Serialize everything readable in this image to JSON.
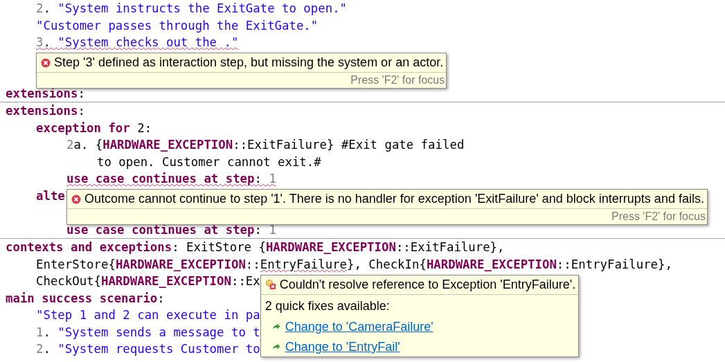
{
  "panels": [
    {
      "lines": [
        {
          "kind": "offscreen",
          "children": [
            {
              "kind": "code",
              "tokens": [
                {
                  "kind": "number",
                  "text": "2",
                  "error": false
                },
                {
                  "kind": "plain",
                  "text": ". ",
                  "error": false
                },
                {
                  "kind": "string",
                  "text": "\"System instructs the ExitGate to open.\"",
                  "error": false
                }
              ]
            },
            {
              "kind": "code",
              "tokens": [
                {
                  "kind": "string",
                  "text": "\"Customer passes through the ExitGate.\"",
                  "error": false
                }
              ]
            },
            {
              "kind": "code",
              "tokens": [
                {
                  "kind": "number",
                  "text": "3",
                  "error": true,
                  "tooltip": {
                    "kind": "error",
                    "message": "Step '3' defined as interaction step, but missing the system or an actor.",
                    "footer": "Press 'F2' for focus"
                  }
                },
                {
                  "kind": "plain",
                  "text": ". ",
                  "error": true
                },
                {
                  "kind": "string",
                  "text": "\"System checks out the .\"",
                  "error": true
                }
              ]
            },
            {
              "kind": "covered"
            },
            {
              "kind": "covered"
            }
          ]
        },
        {
          "kind": "code",
          "tokens": [
            {
              "kind": "keyword",
              "text": "extensions",
              "error": false
            },
            {
              "kind": "plain",
              "text": ":",
              "error": false
            }
          ]
        }
      ]
    },
    {
      "lines": [
        {
          "kind": "code",
          "tokens": [
            {
              "kind": "keyword",
              "text": "extensions",
              "error": false
            },
            {
              "kind": "plain",
              "text": ":",
              "error": false
            }
          ],
          "children": [
            {
              "kind": "code",
              "tokens": [
                {
                  "kind": "keyword",
                  "text": "exception for",
                  "error": false
                },
                {
                  "kind": "plain",
                  "text": " 2:",
                  "error": false
                }
              ],
              "children": [
                {
                  "kind": "code",
                  "tokens": [
                    {
                      "kind": "number",
                      "text": "2",
                      "error": false
                    },
                    {
                      "kind": "plain",
                      "text": "a. {",
                      "error": false
                    },
                    {
                      "kind": "keyword",
                      "text": "HARDWARE_EXCEPTION",
                      "error": false
                    },
                    {
                      "kind": "plain",
                      "text": "::ExitFailure} #Exit gate failed",
                      "error": false
                    }
                  ],
                  "children": [
                    {
                      "kind": "code",
                      "tokens": [
                        {
                          "kind": "plain",
                          "text": "to open. Customer cannot exit.#",
                          "error": false
                        }
                      ]
                    }
                  ]
                },
                {
                  "kind": "code",
                  "tokens": [
                    {
                      "kind": "keyword",
                      "text": "use case continues at step",
                      "error": true,
                      "tooltip": {
                        "kind": "error",
                        "message": "Outcome cannot continue to step '1'. There is no handler for exception 'ExitFailure' and block interrupts and fails.",
                        "footer": "Press 'F2' for focus"
                      }
                    },
                    {
                      "kind": "plain",
                      "text": ": ",
                      "error": true
                    },
                    {
                      "kind": "number",
                      "text": "1",
                      "error": true
                    }
                  ]
                }
              ]
            },
            {
              "kind": "code",
              "tokens": [
                {
                  "kind": "keyword",
                  "text": "alte",
                  "error": false
                }
              ],
              "children": [
                {
                  "kind": "covered"
                },
                {
                  "kind": "code",
                  "tokens": [
                    {
                      "kind": "keyword",
                      "text": "use case continues at step",
                      "error": false
                    },
                    {
                      "kind": "plain",
                      "text": ": ",
                      "error": false
                    },
                    {
                      "kind": "number",
                      "text": "1",
                      "error": false
                    }
                  ]
                }
              ]
            }
          ]
        }
      ]
    },
    {
      "lines": [
        {
          "kind": "code",
          "tokens": [
            {
              "kind": "keyword",
              "text": "contexts and exceptions",
              "error": false
            },
            {
              "kind": "plain",
              "text": ": ExitStore {",
              "error": false
            },
            {
              "kind": "keyword",
              "text": "HARDWARE_EXCEPTION",
              "error": false
            },
            {
              "kind": "plain",
              "text": "::ExitFailure},",
              "error": false
            }
          ],
          "children": [
            {
              "kind": "code",
              "tokens": [
                {
                  "kind": "plain",
                  "text": "EnterStore{",
                  "error": false
                },
                {
                  "kind": "keyword",
                  "text": "HARDWARE_EXCEPTION",
                  "error": false
                },
                {
                  "kind": "plain",
                  "text": "::",
                  "error": false
                },
                {
                  "kind": "plain",
                  "text": "EntryFailure",
                  "error": true,
                  "tooltip": {
                    "kind": "quickfix",
                    "message": "Couldn't resolve reference to Exception 'EntryFailure'.",
                    "fixes_title": "2 quick fixes available:",
                    "fixes": [
                      "Change to 'CameraFailure'",
                      "Change to 'EntryFail'"
                    ]
                  }
                },
                {
                  "kind": "plain",
                  "text": "}, CheckIn{",
                  "error": false
                },
                {
                  "kind": "keyword",
                  "text": "HARDWARE_EXCEPTION",
                  "error": false
                },
                {
                  "kind": "plain",
                  "text": "::EntryFailure},",
                  "error": false
                }
              ]
            },
            {
              "kind": "code",
              "tokens": [
                {
                  "kind": "plain",
                  "text": "CheckOut{",
                  "error": false
                },
                {
                  "kind": "keyword",
                  "text": "HARDWARE_EXCEPTION",
                  "error": false
                },
                {
                  "kind": "plain",
                  "text": "::Ex",
                  "error": false
                }
              ]
            }
          ]
        },
        {
          "kind": "code",
          "tokens": [
            {
              "kind": "keyword",
              "text": "main success scenario",
              "error": false
            },
            {
              "kind": "plain",
              "text": ":",
              "error": false
            }
          ],
          "children": [
            {
              "kind": "code",
              "tokens": [
                {
                  "kind": "string",
                  "text": "\"Step 1 and 2 can execute in pa",
                  "error": false
                }
              ]
            },
            {
              "kind": "code",
              "tokens": [
                {
                  "kind": "number",
                  "text": "1",
                  "error": false
                },
                {
                  "kind": "plain",
                  "text": ". ",
                  "error": false
                },
                {
                  "kind": "string",
                  "text": "\"System sends a message to t",
                  "error": false
                }
              ]
            },
            {
              "kind": "code",
              "tokens": [
                {
                  "kind": "number",
                  "text": "2",
                  "error": false
                },
                {
                  "kind": "plain",
                  "text": ". ",
                  "error": false
                },
                {
                  "kind": "string",
                  "text": "\"System requests Customer to",
                  "error": false
                }
              ]
            }
          ]
        }
      ]
    }
  ]
}
